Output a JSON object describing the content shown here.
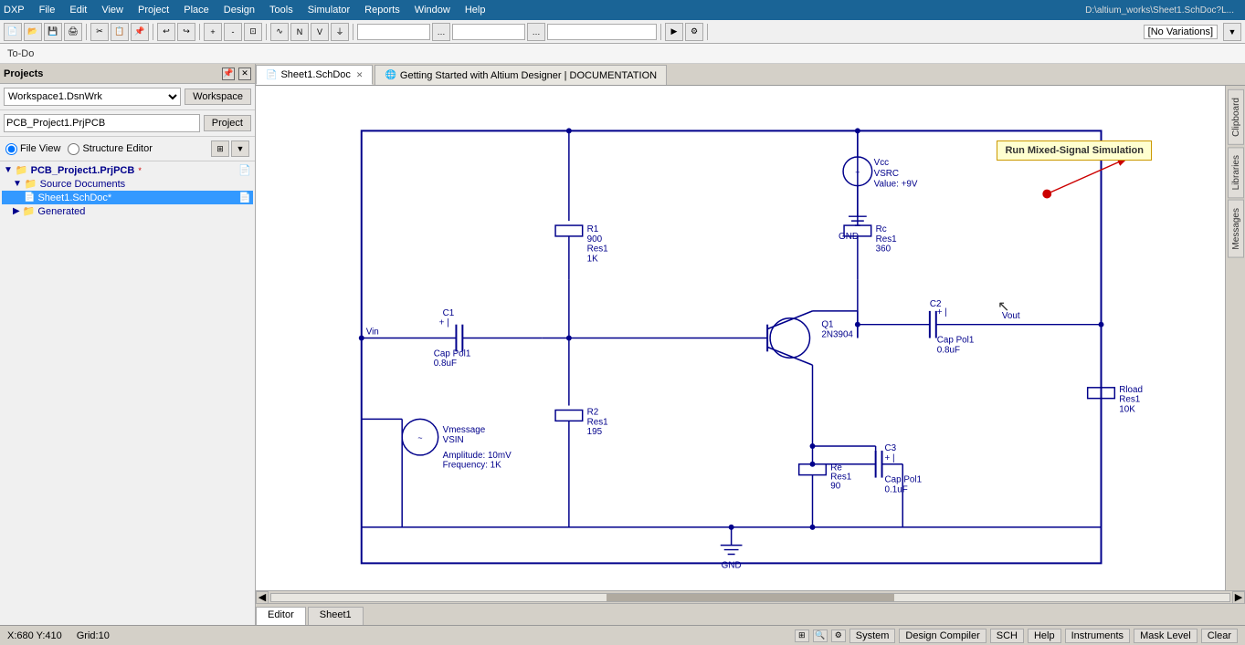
{
  "titlebar": {
    "items": [
      "DXP",
      "File",
      "Edit",
      "View",
      "Project",
      "Place",
      "Design",
      "Tools",
      "Simulator",
      "Reports",
      "Window",
      "Help"
    ]
  },
  "path_bar": {
    "path": "D:\\altium_works\\Sheet1.SchDoc?L..."
  },
  "todo": {
    "label": "To-Do"
  },
  "panel": {
    "title": "Projects",
    "workspace_value": "Workspace1.DsnWrk",
    "workspace_btn": "Workspace",
    "project_value": "PCB_Project1.PrjPCB",
    "project_btn": "Project",
    "fileview_label": "File View",
    "structure_label": "Structure Editor"
  },
  "tree": {
    "items": [
      {
        "label": "PCB_Project1.PrjPCB *",
        "level": 0,
        "icon": "📁",
        "badge": "*"
      },
      {
        "label": "Source Documents",
        "level": 1,
        "icon": "📁"
      },
      {
        "label": "Sheet1.SchDoc *",
        "level": 2,
        "icon": "📄",
        "selected": true,
        "badge": "*"
      },
      {
        "label": "Generated",
        "level": 1,
        "icon": "📁"
      }
    ]
  },
  "tabs": [
    {
      "label": "Sheet1.SchDoc",
      "icon": "📄",
      "active": true,
      "closable": true
    },
    {
      "label": "Getting Started with Altium Designer | DOCUMENTATION",
      "icon": "🌐",
      "active": false,
      "closable": false
    }
  ],
  "editor_tabs": [
    {
      "label": "Editor",
      "active": true
    },
    {
      "label": "Sheet1",
      "active": false
    }
  ],
  "right_sidebar": {
    "tabs": [
      "Clipboard",
      "Libraries",
      "Messages"
    ]
  },
  "annotation": {
    "text": "Run Mixed-Signal Simulation"
  },
  "status": {
    "coords": "X:680 Y:410",
    "grid": "Grid:10",
    "system": "System",
    "design_compiler": "Design Compiler",
    "sch": "SCH",
    "help": "Help",
    "instruments": "Instruments",
    "mask_level": "Mask Level",
    "clear": "Clear"
  },
  "schematic": {
    "components": [
      {
        "ref": "R1",
        "value": "900",
        "type": "Res1",
        "extra": "1K"
      },
      {
        "ref": "Rc",
        "value": "360",
        "type": "Res1"
      },
      {
        "ref": "R2",
        "value": "195",
        "type": "Res1"
      },
      {
        "ref": "Re",
        "value": "90",
        "type": "Res1"
      },
      {
        "ref": "Rload",
        "value": "10K",
        "type": "Res1"
      },
      {
        "ref": "C1",
        "value": "0.8uF",
        "type": "Cap Pol1"
      },
      {
        "ref": "C2",
        "value": "0.8uF",
        "type": "Cap Pol1"
      },
      {
        "ref": "C3",
        "value": "0.1uF",
        "type": "Cap Pol1"
      },
      {
        "ref": "Q1",
        "value": "2N3904",
        "type": "NPN"
      },
      {
        "ref": "Vcc",
        "value": "+9V",
        "type": "VSRC"
      },
      {
        "ref": "Vmessage",
        "value": "Amplitude: 10mV\nFrequency: 1K",
        "type": "VSIN"
      },
      {
        "ref": "GND1",
        "type": "GND"
      },
      {
        "ref": "GND2",
        "type": "GND"
      },
      {
        "ref": "Vin",
        "type": "net"
      },
      {
        "ref": "Vout",
        "type": "net"
      }
    ]
  },
  "variations": {
    "label": "[No Variations]"
  }
}
